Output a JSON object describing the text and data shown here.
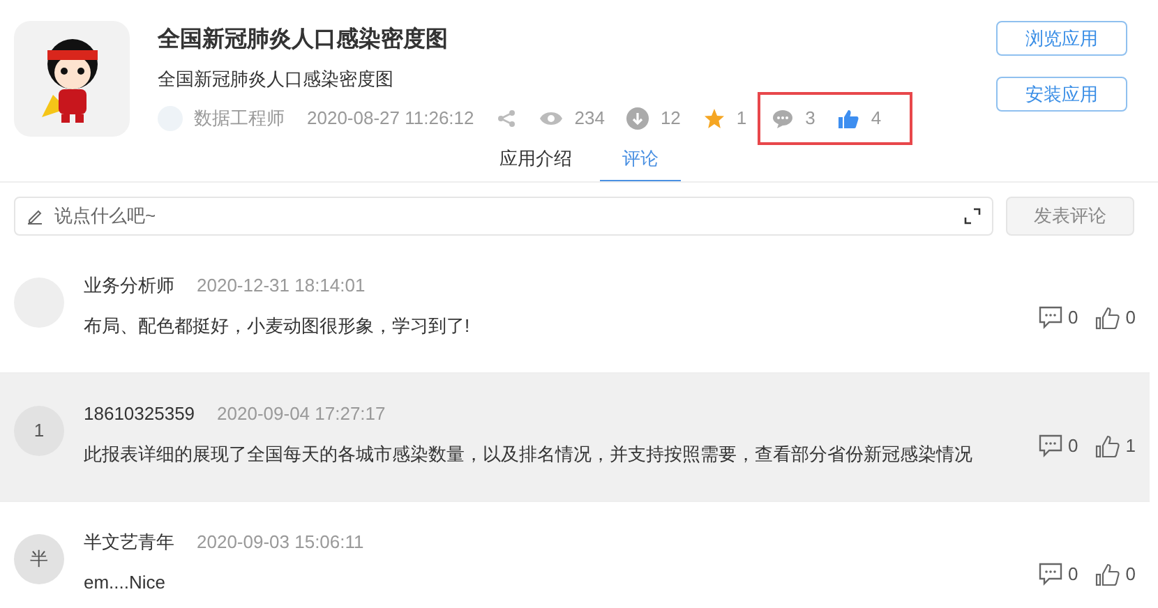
{
  "app": {
    "title": "全国新冠肺炎人口感染密度图",
    "subtitle": "全国新冠肺炎人口感染密度图",
    "author": "数据工程师",
    "date": "2020-08-27 11:26:12",
    "stats": [
      {
        "kind": "share",
        "highlighted": false
      },
      {
        "kind": "views",
        "value": "234",
        "highlighted": false
      },
      {
        "kind": "downloads",
        "value": "12",
        "highlighted": false
      },
      {
        "kind": "favorites",
        "value": "1",
        "highlighted": false
      },
      {
        "kind": "comments",
        "value": "3",
        "highlighted": true
      },
      {
        "kind": "likes",
        "value": "4",
        "highlighted": true
      }
    ],
    "buttons": [
      "浏览应用",
      "安装应用"
    ]
  },
  "tabs": [
    {
      "label": "应用介绍",
      "selected": false
    },
    {
      "label": "评论",
      "selected": true
    }
  ],
  "comment_box": {
    "placeholder": "说点什么吧~",
    "submit": "发表评论"
  },
  "comments": [
    {
      "user": "业务分析师",
      "time": "2020-12-31 18:14:01",
      "text": "布局、配色都挺好，小麦动图很形象，学习到了!",
      "replies": "0",
      "likes": "0",
      "highlighted": false
    },
    {
      "avatar_text": "1",
      "user": "18610325359",
      "time": "2020-09-04 17:27:17",
      "text": "此报表详细的展现了全国每天的各城市感染数量，以及排名情况，并支持按照需要，查看部分省份新冠感染情况",
      "replies": "0",
      "likes": "1",
      "highlighted": true
    },
    {
      "avatar_text": "半",
      "user": "半文艺青年",
      "time": "2020-09-03 15:06:11",
      "text": "em....Nice",
      "replies": "0",
      "likes": "0",
      "highlighted": false
    }
  ]
}
